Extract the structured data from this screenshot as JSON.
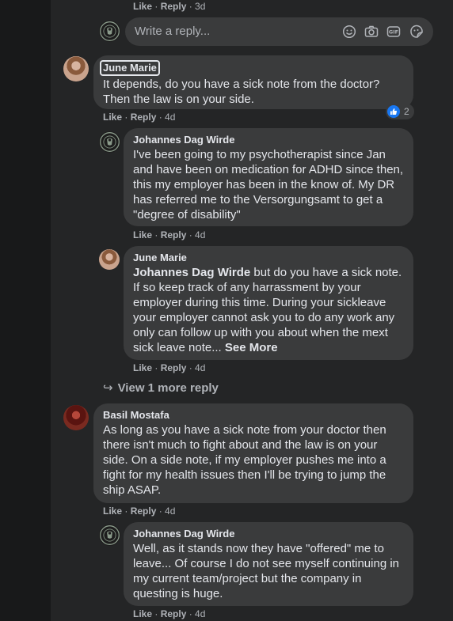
{
  "top_actions": {
    "like": "Like",
    "reply": "Reply",
    "time": "3d"
  },
  "reply_box": {
    "placeholder": "Write a reply..."
  },
  "comments": [
    {
      "author": "June Marie",
      "text": "It depends, do you have a sick note from the doctor? Then the law is on your side.",
      "reaction_count": "2",
      "like": "Like",
      "reply": "Reply",
      "time": "4d"
    },
    {
      "author": "Johannes Dag Wirde",
      "text": "I've been going to my psychotherapist since Jan and have been on medication for ADHD since then, this my employer has been in the know of. My DR has referred me to the Versorgungsamt to get a \"degree of disability\"",
      "like": "Like",
      "reply": "Reply",
      "time": "4d"
    },
    {
      "author": "June Marie",
      "mention": "Johannes Dag Wirde",
      "text": " but do you have a sick note. If so keep track of any harrassment by your employer during this time. During your sickleave your employer cannot ask you to do any work any only can follow up with you about when the mext sick leave note...",
      "see_more": "See More",
      "like": "Like",
      "reply": "Reply",
      "time": "4d"
    },
    {
      "author": "Basil Mostafa",
      "text": "As long as you have a sick note from your doctor then there isn't much to fight about and the law is on your side. On a side note, if my employer pushes me into a fight for my health issues then I'll be trying to jump the ship ASAP.",
      "like": "Like",
      "reply": "Reply",
      "time": "4d"
    },
    {
      "author": "Johannes Dag Wirde",
      "text": "Well, as it stands now they have \"offered\" me to leave... Of course I do not see myself continuing in my current team/project but the company in questing is huge.",
      "like": "Like",
      "reply": "Reply",
      "time": "4d"
    }
  ],
  "view_more": {
    "label": "View 1 more reply"
  },
  "icons": [
    "emoji-icon",
    "camera-icon",
    "gif-icon",
    "sticker-icon",
    "like-icon",
    "reply-arrow-icon"
  ],
  "colors": {
    "background": "#18191a",
    "panel": "#242526",
    "bubble": "#3a3b3c",
    "text": "#e4e6eb",
    "secondary": "#b0b3b8",
    "like_blue": "#1877f2"
  }
}
